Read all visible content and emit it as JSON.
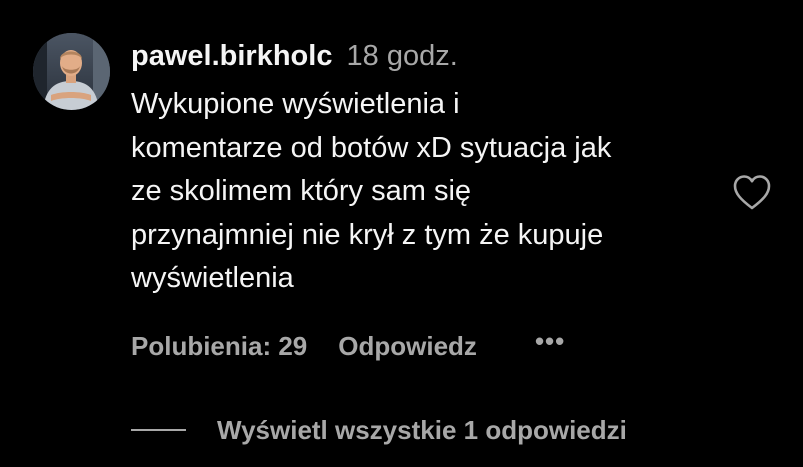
{
  "comment": {
    "author": {
      "username": "pawel.birkholc",
      "avatar_icon": "user-avatar-photo"
    },
    "timestamp": "18 godz.",
    "text": "Wykupione wyświetlenia i\nkomentarze od botów xD sytuacja jak\nze skolimem który sam się\nprzynajmniej nie krył z tym że kupuje\nwyświetlenia",
    "likes_label": "Polubienia: 29",
    "reply_label": "Odpowiedz",
    "more_icon": "•••",
    "like_icon": "heart-outline-icon",
    "view_replies_label": "Wyświetl wszystkie 1 odpowiedzi"
  },
  "colors": {
    "background": "#000000",
    "primary_text": "#f5f5f5",
    "secondary_text": "#a8a8a8"
  }
}
